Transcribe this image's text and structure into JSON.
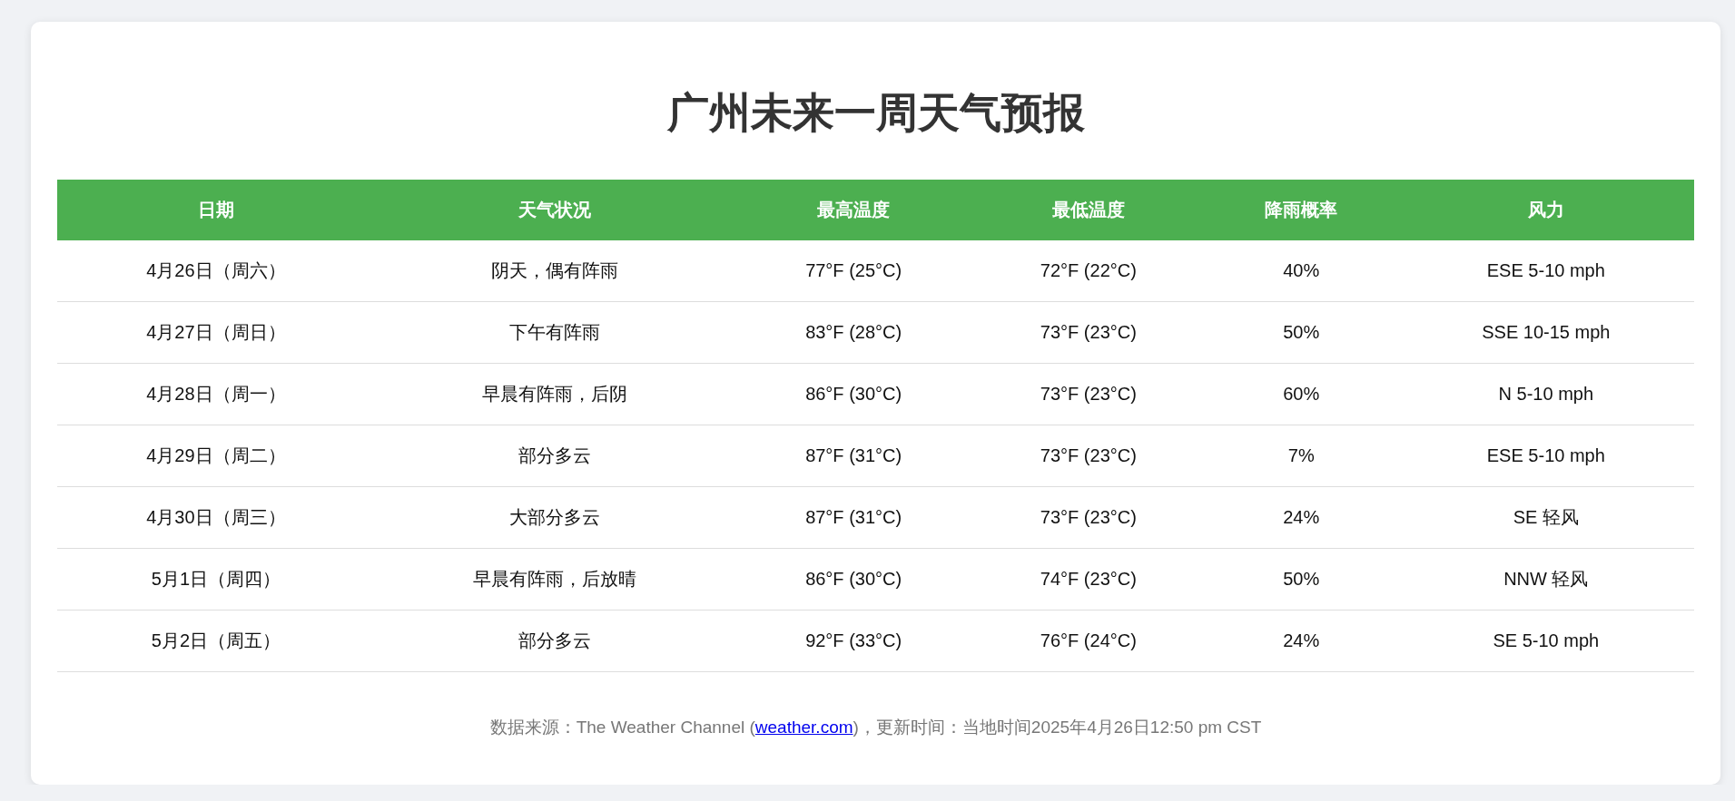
{
  "title": "广州未来一周天气预报",
  "table": {
    "columns": [
      "日期",
      "天气状况",
      "最高温度",
      "最低温度",
      "降雨概率",
      "风力"
    ],
    "rows": [
      [
        "4月26日（周六）",
        "阴天，偶有阵雨",
        "77°F (25°C)",
        "72°F (22°C)",
        "40%",
        "ESE 5-10 mph"
      ],
      [
        "4月27日（周日）",
        "下午有阵雨",
        "83°F (28°C)",
        "73°F (23°C)",
        "50%",
        "SSE 10-15 mph"
      ],
      [
        "4月28日（周一）",
        "早晨有阵雨，后阴",
        "86°F (30°C)",
        "73°F (23°C)",
        "60%",
        "N 5-10 mph"
      ],
      [
        "4月29日（周二）",
        "部分多云",
        "87°F (31°C)",
        "73°F (23°C)",
        "7%",
        "ESE 5-10 mph"
      ],
      [
        "4月30日（周三）",
        "大部分多云",
        "87°F (31°C)",
        "73°F (23°C)",
        "24%",
        "SE 轻风"
      ],
      [
        "5月1日（周四）",
        "早晨有阵雨，后放晴",
        "86°F (30°C)",
        "74°F (23°C)",
        "50%",
        "NNW 轻风"
      ],
      [
        "5月2日（周五）",
        "部分多云",
        "92°F (33°C)",
        "76°F (24°C)",
        "24%",
        "SE 5-10 mph"
      ]
    ]
  },
  "footer": {
    "prefix": "数据来源：The Weather Channel (",
    "link": "weather.com",
    "suffix": ")，更新时间：当地时间2025年4月26日12:50 pm CST"
  }
}
